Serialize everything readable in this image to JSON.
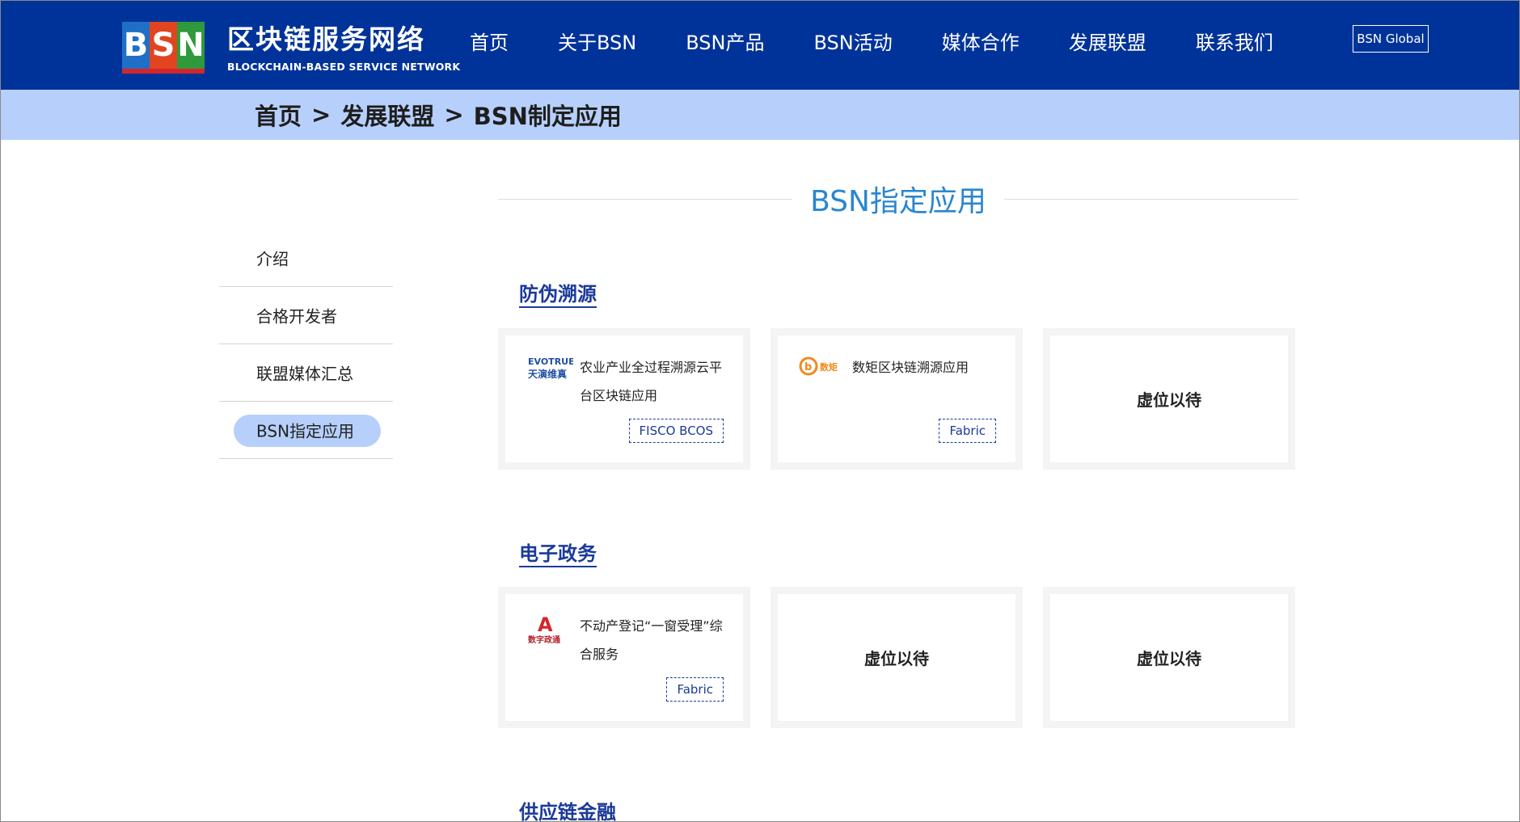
{
  "header": {
    "logo_letters": [
      "B",
      "S",
      "N"
    ],
    "logo_cn": "区块链服务网络",
    "logo_en": "BLOCKCHAIN-BASED SERVICE NETWORK",
    "nav": [
      "首页",
      "关于BSN",
      "BSN产品",
      "BSN活动",
      "媒体合作",
      "发展联盟",
      "联系我们"
    ],
    "global_label": "BSN Global",
    "bg_color": "#003399"
  },
  "breadcrumb": {
    "items": [
      "首页",
      "发展联盟",
      "BSN制定应用"
    ],
    "separator": ">"
  },
  "sidebar": {
    "items": [
      {
        "label": "介绍",
        "active": false
      },
      {
        "label": "合格开发者",
        "active": false
      },
      {
        "label": "联盟媒体汇总",
        "active": false
      },
      {
        "label": "BSN指定应用",
        "active": true
      }
    ]
  },
  "main": {
    "title": "BSN指定应用",
    "categories": [
      {
        "title": "防伪溯源",
        "cards": [
          {
            "logo": "evotrue-logo",
            "logo_text": "EVOTRUE",
            "logo_sub": "天演维真",
            "name": "农业产业全过程溯源云平台区块链应用",
            "tag": "FISCO BCOS"
          },
          {
            "logo": "chinaDT-logo",
            "logo_text": "数矩",
            "name": "数矩区块链溯源应用",
            "tag": "Fabric"
          },
          {
            "placeholder": "虚位以待"
          }
        ]
      },
      {
        "title": "电子政务",
        "cards": [
          {
            "logo": "digital-gov-logo",
            "logo_text": "A",
            "logo_sub": "数字政通",
            "name": "不动产登记“一窗受理”综合服务",
            "tag": "Fabric"
          },
          {
            "placeholder": "虚位以待"
          },
          {
            "placeholder": "虚位以待"
          }
        ]
      },
      {
        "title": "供应链金融",
        "cards": []
      }
    ]
  }
}
